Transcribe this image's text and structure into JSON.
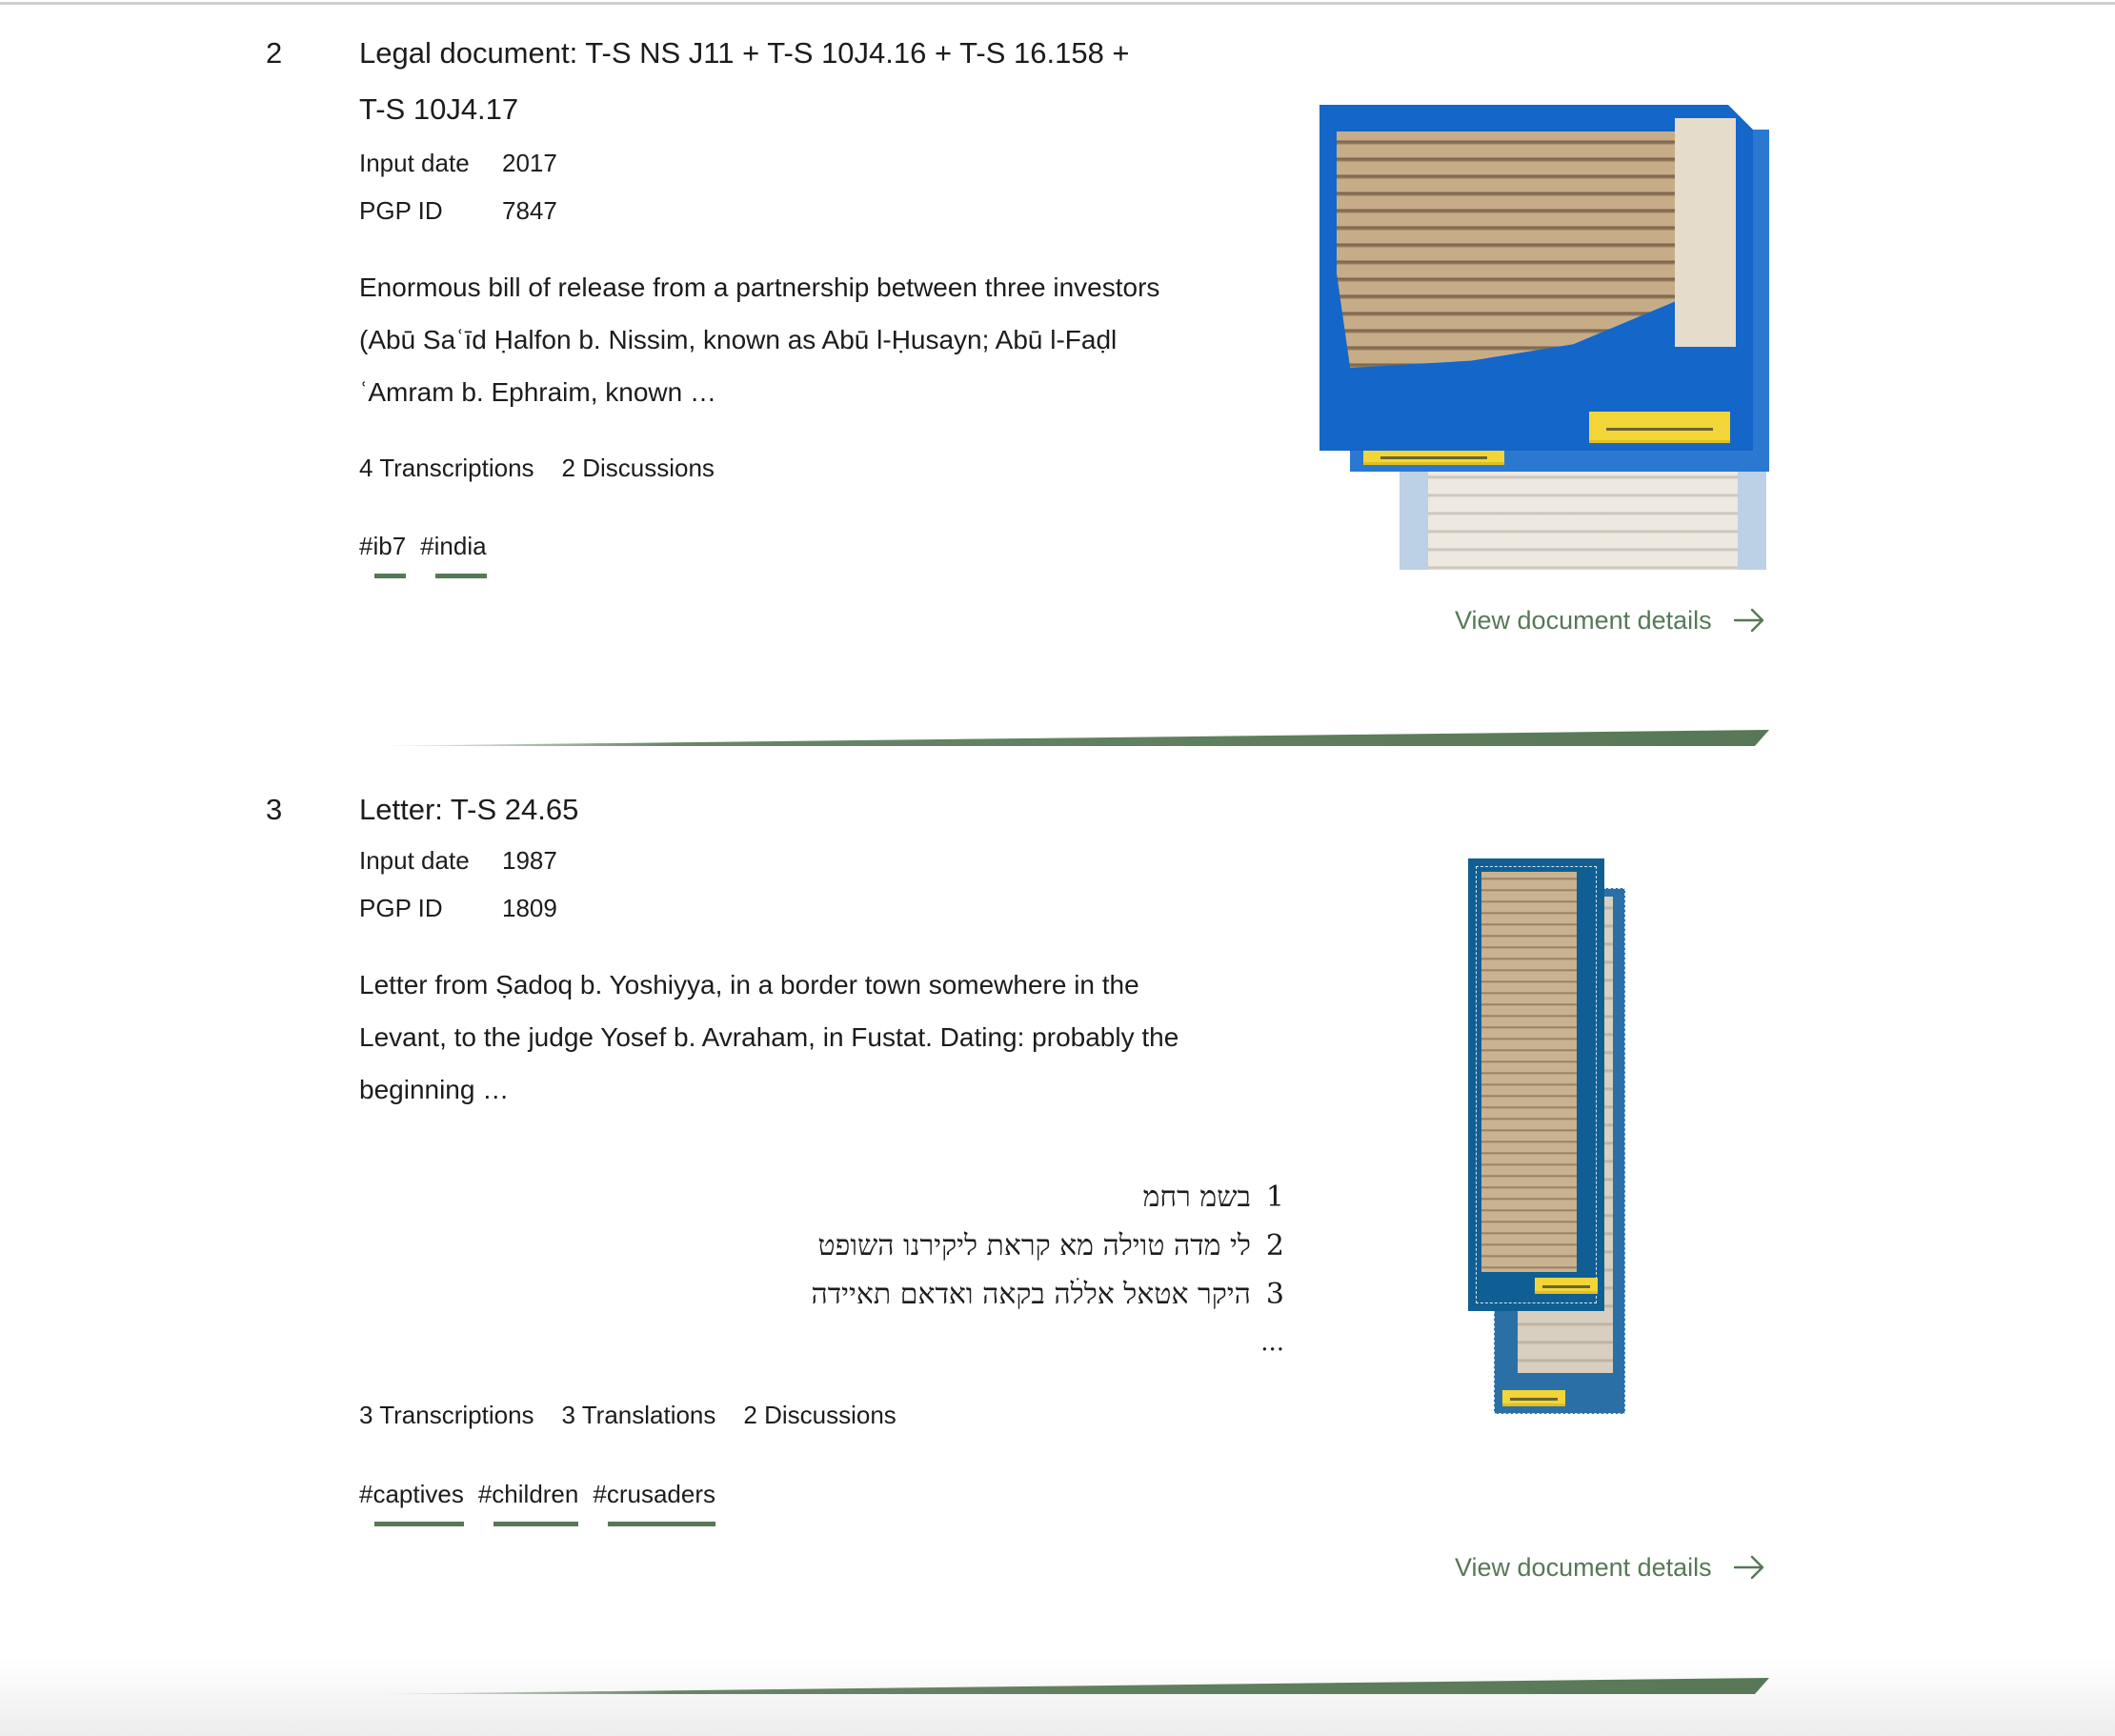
{
  "colors": {
    "accent_green": "#577856",
    "text": "#1c1c1c",
    "thumbnail_blue": "#1566c9",
    "thumbnail_teal": "#0f5f94",
    "parchment": "#c7ad87"
  },
  "results": [
    {
      "number": "2",
      "title_line1": "Legal document: T-S NS J11 + T-S 10J4.16 + T-S 16.158 +",
      "title_line2": "T-S 10J4.17",
      "meta": {
        "input_date_label": "Input date",
        "input_date": "2017",
        "pgp_id_label": "PGP ID",
        "pgp_id": "7847"
      },
      "description": [
        "Enormous bill of release from a partnership between three investors",
        "(Abū Saʿīd Ḥalfon b. Nissim, known as Abū l-Ḥusayn; Abū l-Faḍl",
        "ʿAmram b. Ephraim, known …"
      ],
      "counts": [
        "4 Transcriptions",
        "2 Discussions"
      ],
      "tags": [
        "#ib7",
        "#india"
      ],
      "thumbnail_icon": "manuscript-thumbnail-icon",
      "view_details_label": "View document details",
      "view_details_icon": "arrow-right-icon"
    },
    {
      "number": "3",
      "title_line1": "Letter: T-S 24.65",
      "meta": {
        "input_date_label": "Input date",
        "input_date": "1987",
        "pgp_id_label": "PGP ID",
        "pgp_id": "1809"
      },
      "description": [
        "Letter from Ṣadoq b. Yoshiyya, in a border town somewhere in the",
        "Levant, to the judge Yosef b. Avraham, in Fustat. Dating: probably the",
        "beginning …"
      ],
      "transcription_excerpt": [
        {
          "line": "1",
          "text": "בשמ רחמ"
        },
        {
          "line": "2",
          "text": "לי מדה טוילה מא קראת ליקירנו השופט"
        },
        {
          "line": "3",
          "text": "היקר אטאל אללׄה בקאה ואדאם תאיידה"
        }
      ],
      "transcription_ellipsis": "...",
      "counts": [
        "3 Transcriptions",
        "3 Translations",
        "2 Discussions"
      ],
      "tags": [
        "#captives",
        "#children",
        "#crusaders"
      ],
      "thumbnail_icon": "manuscript-thumbnail-icon",
      "view_details_label": "View document details",
      "view_details_icon": "arrow-right-icon"
    }
  ]
}
